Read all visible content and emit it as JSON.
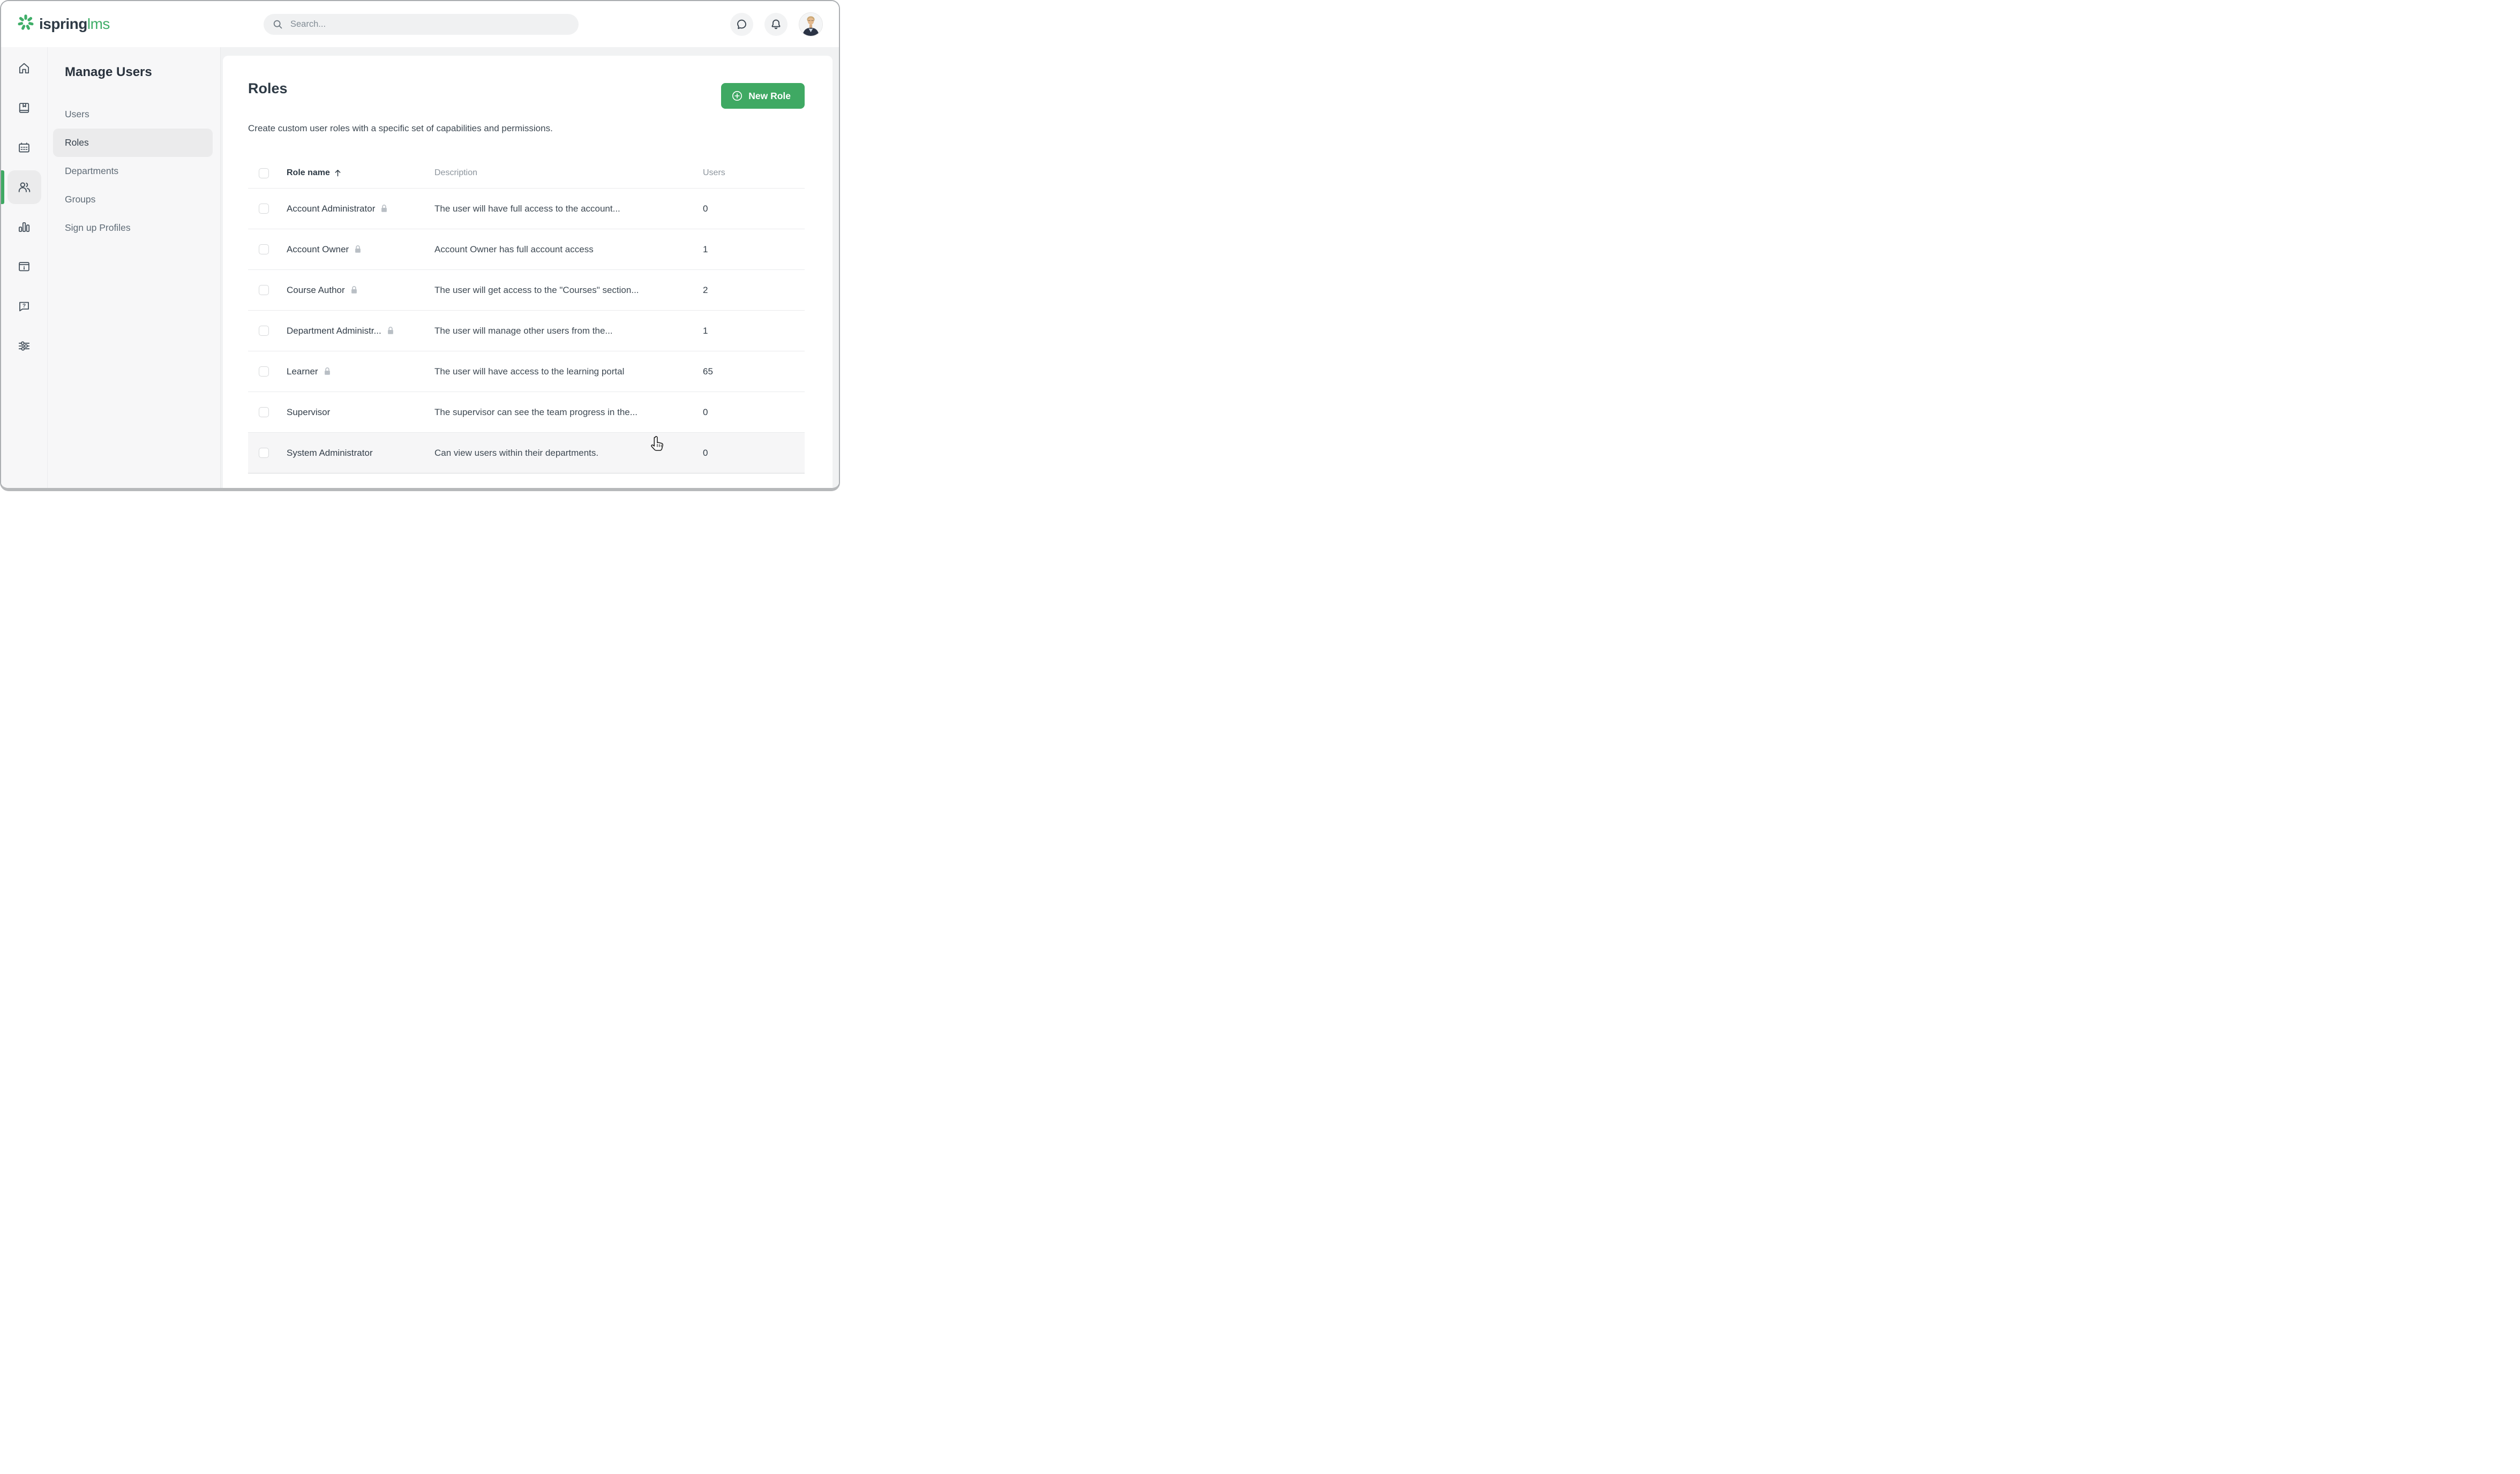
{
  "topbar": {
    "brand": "ispring",
    "brand_suffix": "lms",
    "search_placeholder": "Search...",
    "icons": [
      "messages-icon",
      "notifications-icon",
      "user-avatar"
    ]
  },
  "sidebar": {
    "active_index": 3,
    "items": [
      {
        "icon": "home-icon"
      },
      {
        "icon": "book-icon"
      },
      {
        "icon": "calendar-icon"
      },
      {
        "icon": "users-icon"
      },
      {
        "icon": "bar-chart-icon"
      },
      {
        "icon": "info-window-icon"
      },
      {
        "icon": "help-icon"
      },
      {
        "icon": "sliders-icon"
      }
    ]
  },
  "nav": {
    "title": "Manage Users",
    "items": [
      "Users",
      "Roles",
      "Departments",
      "Groups",
      "Sign up Profiles"
    ],
    "selected_index": 1
  },
  "content": {
    "title": "Roles",
    "new_role_button": "New Role",
    "description": "Create custom user roles with a specific set of capabilities and permissions.",
    "table": {
      "headers": {
        "role": "Role name",
        "description": "Description",
        "users": "Users"
      },
      "sort": {
        "column": "Role name",
        "direction": "ascending"
      },
      "hovered_row_index": 6,
      "rows": [
        {
          "name": "Account Administrator",
          "locked": true,
          "description": "The user will have full access to the account...",
          "users": "0"
        },
        {
          "name": "Account Owner",
          "locked": true,
          "description": "Account Owner has full account access",
          "users": "1"
        },
        {
          "name": "Course Author",
          "locked": true,
          "description": "The user will get access to the \"Courses\" section...",
          "users": "2"
        },
        {
          "name": "Department Administr...",
          "locked": true,
          "description": "The user will manage other users from the...",
          "users": "1"
        },
        {
          "name": "Learner",
          "locked": true,
          "description": "The user will have access to the learning portal",
          "users": "65"
        },
        {
          "name": "Supervisor",
          "locked": false,
          "description": "The supervisor can see the team progress in the...",
          "users": "0"
        },
        {
          "name": "System Administrator",
          "locked": false,
          "description": "Can view users within their departments.",
          "users": "0"
        }
      ]
    }
  },
  "colors": {
    "accent_green": "#3fa963",
    "logo_green": "#3fae68",
    "text_dark": "#2e3a45",
    "text_gray": "#8d959d"
  }
}
